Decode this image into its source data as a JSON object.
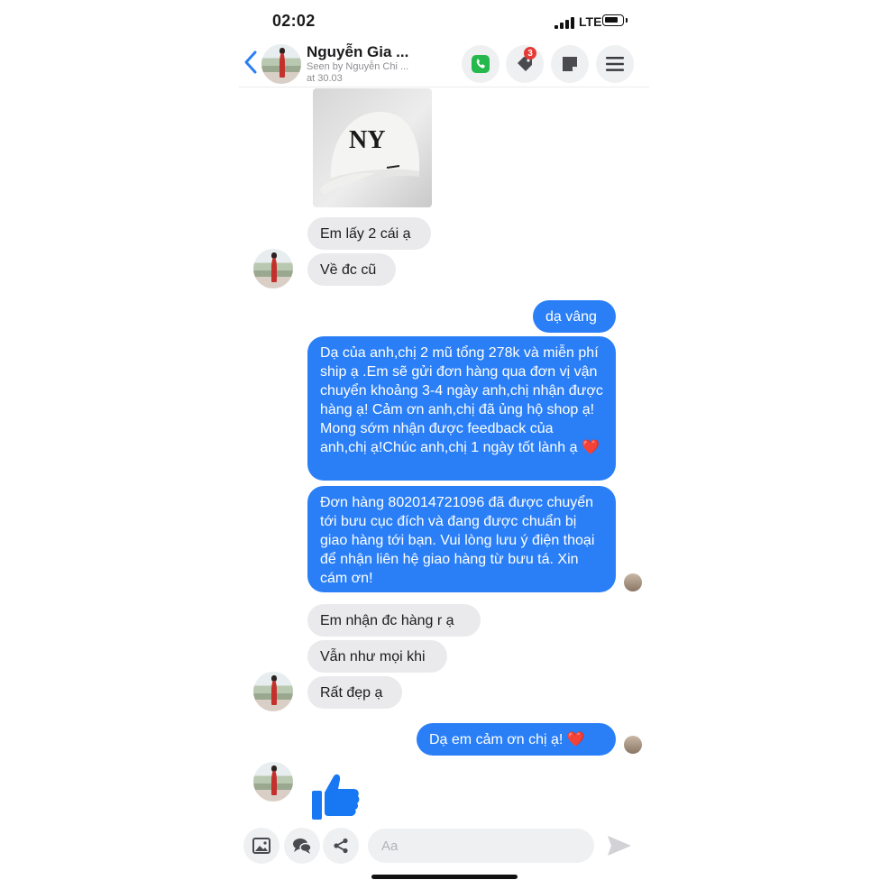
{
  "status_bar": {
    "time": "02:02",
    "network": "LTE"
  },
  "header": {
    "contact_name": "Nguyễn Gia ...",
    "seen_text": "Seen by Nguyễn Chi ...",
    "seen_time": "at 30.03",
    "notification_badge": "3"
  },
  "messages": [
    {
      "side": "in",
      "type": "image",
      "content": "cap-photo"
    },
    {
      "side": "in",
      "text": "Em lấy 2 cái ạ"
    },
    {
      "side": "in",
      "text": "Về đc cũ"
    },
    {
      "side": "out",
      "text": "dạ vâng"
    },
    {
      "side": "out",
      "text": "Dạ của anh,chị 2 mũ tổng 278k và miễn phí ship ạ .Em sẽ gửi đơn hàng qua đơn vị vận chuyển khoảng 3-4 ngày anh,chị nhận được hàng ạ! Cảm ơn anh,chị đã ủng hộ shop ạ! Mong sớm nhận được feedback của anh,chị ạ!Chúc anh,chị 1 ngày tốt lành ạ",
      "emoji": "❤️"
    },
    {
      "side": "out",
      "text": "Đơn hàng 802014721096 đã được chuyển tới bưu cục đích và đang được chuẩn bị giao hàng tới bạn. Vui lòng lưu ý điện thoại để nhận liên hệ giao hàng từ bưu tá. Xin cám ơn!"
    },
    {
      "side": "in",
      "text": "Em nhận đc hàng r ạ"
    },
    {
      "side": "in",
      "text": "Vẫn như mọi khi"
    },
    {
      "side": "in",
      "text": "Rất đẹp ạ"
    },
    {
      "side": "out",
      "text": "Dạ em cảm ơn chị ạ!",
      "emoji": "❤️"
    },
    {
      "side": "in",
      "type": "sticker",
      "content": "thumbs-up"
    }
  ],
  "composer": {
    "placeholder": "Aa"
  },
  "colors": {
    "accent": "#2a7ff7",
    "incoming_bubble": "#eaeaec",
    "heart": "#e0245e",
    "badge": "#e53935"
  }
}
